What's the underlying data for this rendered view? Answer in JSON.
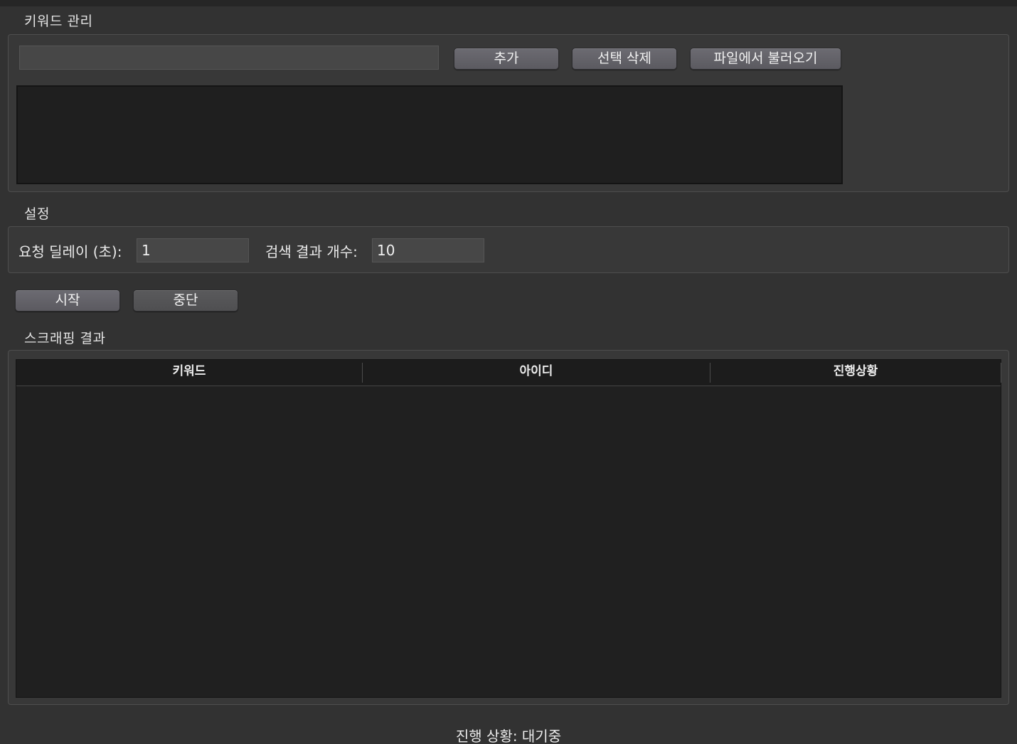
{
  "keyword_section": {
    "title": "키워드 관리",
    "input_value": "",
    "add_label": "추가",
    "delete_label": "선택 삭제",
    "load_file_label": "파일에서 불러오기",
    "keywords": []
  },
  "settings_section": {
    "title": "설정",
    "delay_label": "요청 딜레이 (초):",
    "delay_value": "1",
    "result_count_label": "검색 결과 개수:",
    "result_count_value": "10"
  },
  "controls": {
    "start_label": "시작",
    "stop_label": "중단"
  },
  "results_section": {
    "title": "스크래핑 결과",
    "columns": [
      "키워드",
      "아이디",
      "진행상황"
    ],
    "rows": []
  },
  "status_bar": {
    "text": "진행 상황: 대기중"
  }
}
